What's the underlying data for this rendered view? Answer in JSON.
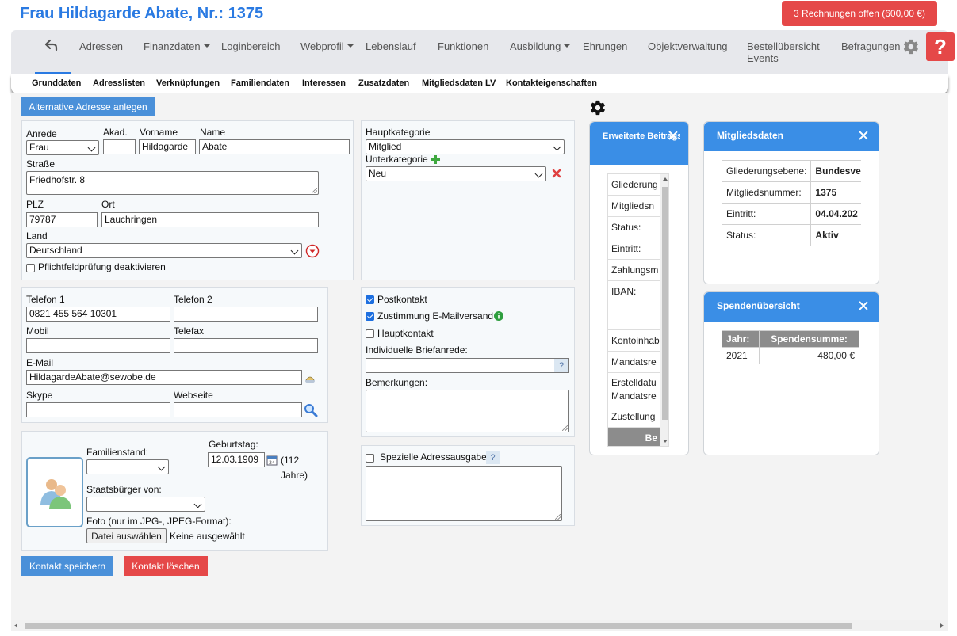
{
  "header": {
    "title": "Frau Hildagarde Abate, Nr.: 1375",
    "invoice_button": "3 Rechnungen offen (600,00 €)"
  },
  "nav": {
    "items": [
      "Adressen",
      "Finanzdaten",
      "Loginbereich",
      "Webprofil",
      "Lebenslauf",
      "Funktionen",
      "Ausbildung",
      "Ehrungen",
      "Objektverwaltung",
      "Bestellübersicht Events",
      "Befragungen"
    ],
    "help": "?"
  },
  "subtabs": [
    "Grunddaten",
    "Adresslisten",
    "Verknüpfungen",
    "Familiendaten",
    "Interessen",
    "Zusatzdaten",
    "Mitgliedsdaten LV",
    "Kontakteigenschaften"
  ],
  "buttons": {
    "alt_address": "Alternative Adresse anlegen",
    "save": "Kontakt speichern",
    "delete": "Kontakt löschen",
    "choose_file": "Datei auswählen"
  },
  "address": {
    "anrede_label": "Anrede",
    "anrede": "Frau",
    "akad_label": "Akad.",
    "akad": "",
    "vorname_label": "Vorname",
    "vorname": "Hildagarde",
    "name_label": "Name",
    "name": "Abate",
    "strasse_label": "Straße",
    "strasse": "Friedhofstr. 8",
    "plz_label": "PLZ",
    "plz": "79787",
    "ort_label": "Ort",
    "ort": "Lauchringen",
    "land_label": "Land",
    "land": "Deutschland",
    "pflicht_label": "Pflichtfeldprüfung deaktivieren"
  },
  "category": {
    "haupt_label": "Hauptkategorie",
    "haupt": "Mitglied",
    "unter_label": "Unterkategorie",
    "unter": "Neu"
  },
  "contact": {
    "telefon1_label": "Telefon 1",
    "telefon1": "0821 455 564 10301",
    "telefon2_label": "Telefon 2",
    "telefon2": "",
    "mobil_label": "Mobil",
    "mobil": "",
    "telefax_label": "Telefax",
    "telefax": "",
    "email_label": "E-Mail",
    "email": "HildagardeAbate@sewobe.de",
    "skype_label": "Skype",
    "skype": "",
    "webseite_label": "Webseite",
    "webseite": ""
  },
  "options": {
    "postkontakt": "Postkontakt",
    "postkontakt_checked": true,
    "email_consent": "Zustimmung E-Mailversand",
    "email_consent_checked": true,
    "hauptkontakt": "Hauptkontakt",
    "hauptkontakt_checked": false,
    "briefanrede_label": "Individuelle Briefanrede:",
    "bemerkungen_label": "Bemerkungen:",
    "spezielle_label": "Spezielle Adressausgabe:"
  },
  "personal": {
    "familienstand_label": "Familienstand:",
    "geburtstag_label": "Geburtstag:",
    "geburtstag": "12.03.1909",
    "age": "(112 Jahre)",
    "staatsbuerger_label": "Staatsbürger von:",
    "foto_label": "Foto (nur im JPG-, JPEG-Format):",
    "no_file": "Keine ausgewählt"
  },
  "beitrag": {
    "title": "Erweiterte Beitragsinformationen",
    "rows": [
      "Gliederung",
      "Mitgliedsn",
      "Status:",
      "Eintritt:",
      "Zahlungsm",
      "IBAN:",
      "Kontoinhab",
      "Mandatsre",
      "Erstelldatu Mandatsre",
      "Zustellung"
    ],
    "footer": "Be"
  },
  "mitglied": {
    "title": "Mitgliedsdaten",
    "rows": [
      {
        "label": "Gliederungsebene:",
        "value": "Bundesver"
      },
      {
        "label": "Mitgliedsnummer:",
        "value": "1375"
      },
      {
        "label": "Eintritt:",
        "value": "04.04.202"
      },
      {
        "label": "Status:",
        "value": "Aktiv"
      }
    ]
  },
  "spenden": {
    "title": "Spendenübersicht",
    "headers": [
      "Jahr:",
      "Spendensumme:"
    ],
    "rows": [
      {
        "year": "2021",
        "sum": "480,00 €"
      }
    ]
  },
  "colors": {
    "brand_blue": "#2a7ae2",
    "danger_red": "#e54848",
    "button_blue": "#4a90d9",
    "card_header": "#3a8ee6"
  }
}
